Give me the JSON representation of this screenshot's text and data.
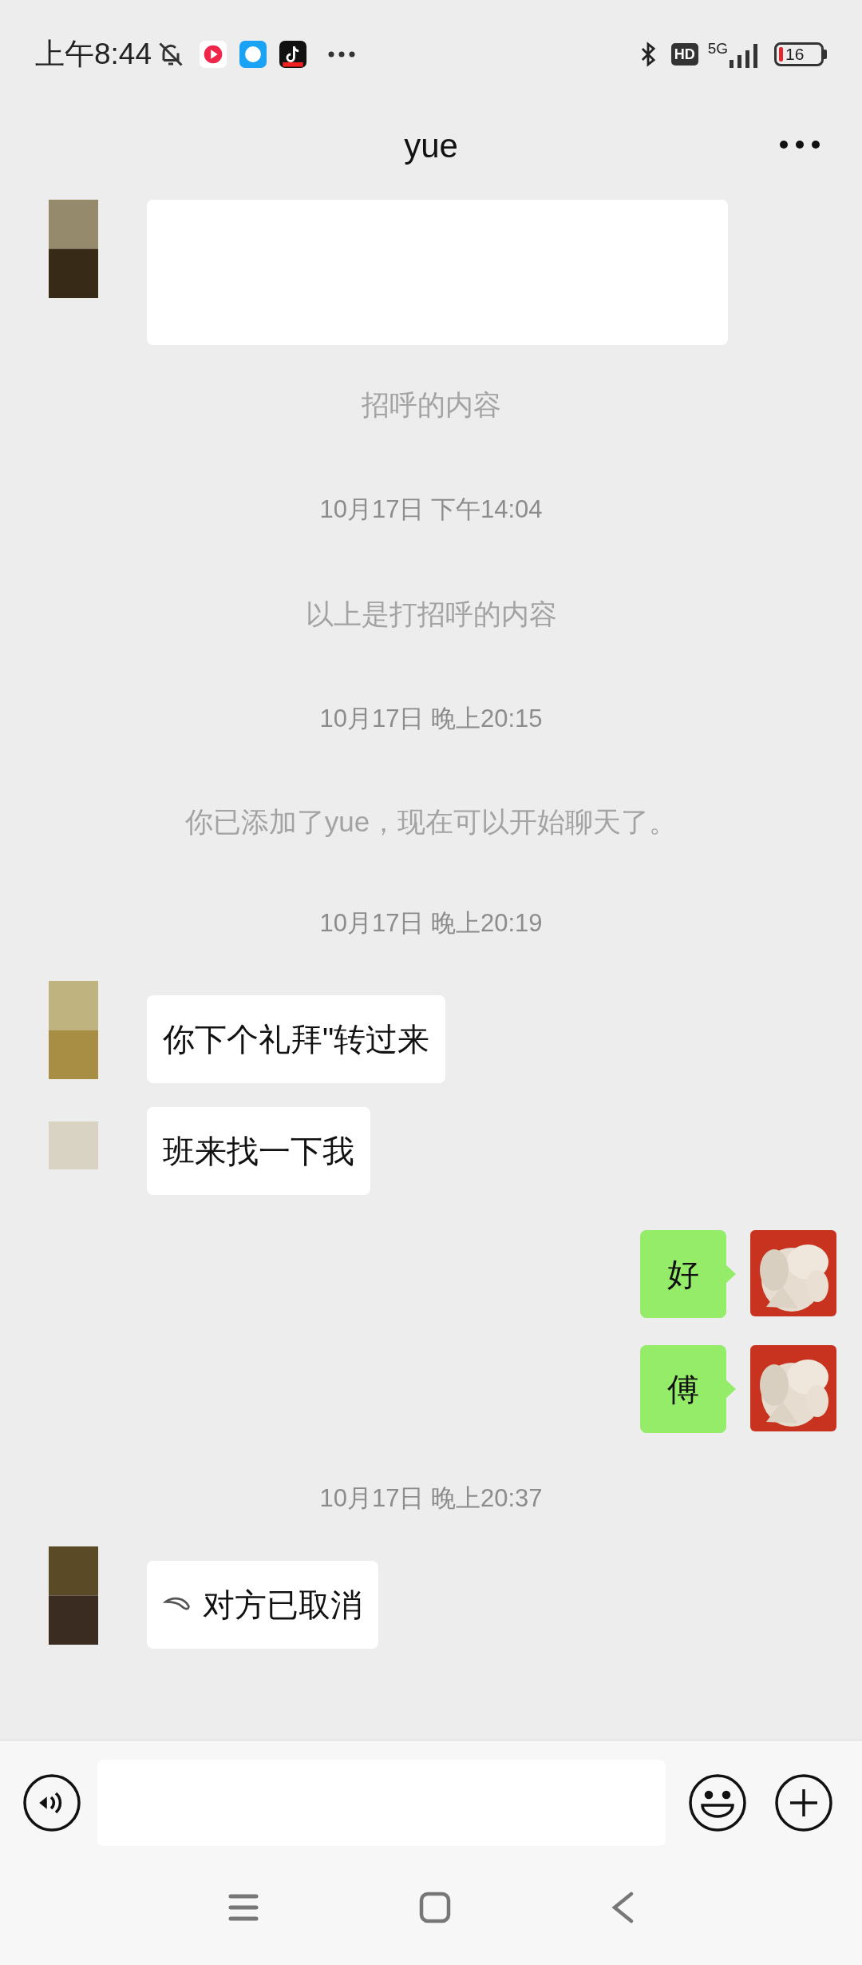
{
  "status_bar": {
    "time": "上午8:44",
    "hd": "HD",
    "network": "5G",
    "battery": "16"
  },
  "header": {
    "title": "yue"
  },
  "messages": [
    {
      "kind": "incoming_blank"
    },
    {
      "kind": "system",
      "text": "招呼的内容"
    },
    {
      "kind": "time",
      "text": "10月17日 下午14:04"
    },
    {
      "kind": "system",
      "text": "以上是打招呼的内容"
    },
    {
      "kind": "time",
      "text": "10月17日 晚上20:15"
    },
    {
      "kind": "system",
      "text": "你已添加了yue，现在可以开始聊天了。"
    },
    {
      "kind": "time",
      "text": "10月17日 晚上20:19"
    },
    {
      "kind": "incoming",
      "text": "你下个礼拜\"转过来"
    },
    {
      "kind": "incoming",
      "text": "班来找一下我"
    },
    {
      "kind": "outgoing",
      "text": "好"
    },
    {
      "kind": "outgoing",
      "text": "傅"
    },
    {
      "kind": "time",
      "text": "10月17日 晚上20:37"
    },
    {
      "kind": "call",
      "text": "对方已取消"
    }
  ]
}
